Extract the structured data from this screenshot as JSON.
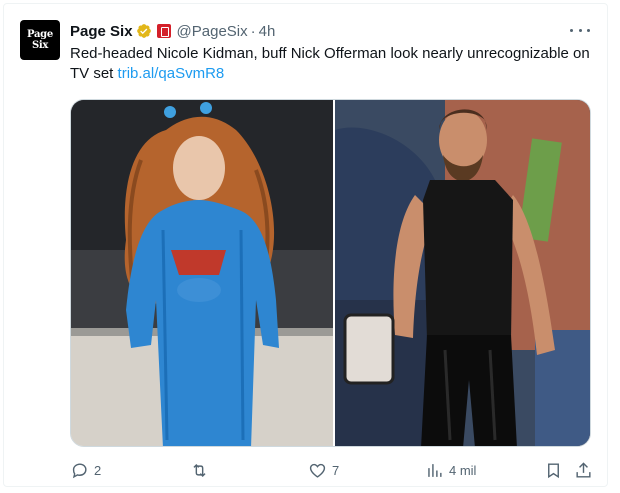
{
  "tweet": {
    "author_name": "Page Six",
    "avatar_line1": "Page",
    "avatar_line2": "Six",
    "handle": "@PageSix",
    "separator": "·",
    "time": "4h",
    "text": "Red-headed Nicole Kidman, buff Nick Offerman look nearly unrecognizable on TV set",
    "link": "trib.al/qaSvmR8",
    "media": [
      {
        "icon": "photo-woman-blue-dress"
      },
      {
        "icon": "photo-man-black-tanktop"
      }
    ]
  },
  "actions": {
    "replies": "2",
    "reposts": "",
    "likes": "7",
    "views": "4 mil"
  },
  "colors": {
    "accent": "#1d9bf0",
    "secondary_text": "#536471",
    "verified_gold": "#e2b719",
    "affiliate_red": "#d4202a"
  }
}
